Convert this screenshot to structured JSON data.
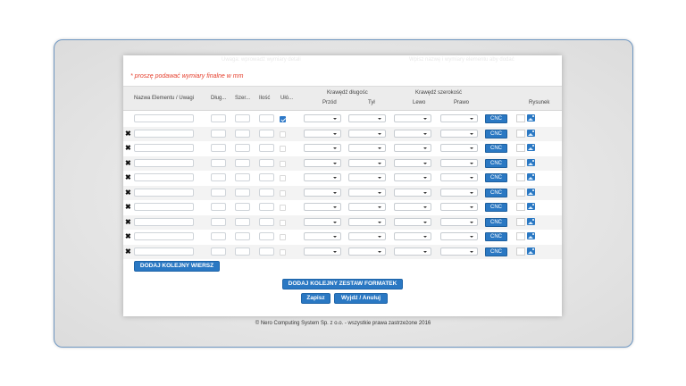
{
  "note": "* proszę podawać wymiary finalne w mm",
  "ghost": {
    "center": "Uwaga: wprowadź wymiary detali",
    "right": "Wpisz nazwę i wymiary elementu aby dodać"
  },
  "headers": {
    "name": "Nazwa Elementu / Uwagi",
    "length": "Dług...",
    "width": "Szer...",
    "qty": "Ilość",
    "grain": "Ułó...",
    "edge_length": "Krawędź długośc",
    "front": "Przód",
    "back": "Tył",
    "edge_width": "Krawędź szerokość",
    "left": "Lewo",
    "right": "Prawo",
    "drawing": "Rysunek"
  },
  "rows": [
    {
      "deletable": false,
      "grain_checked": true
    },
    {
      "deletable": true,
      "grain_checked": false
    },
    {
      "deletable": true,
      "grain_checked": false
    },
    {
      "deletable": true,
      "grain_checked": false
    },
    {
      "deletable": true,
      "grain_checked": false
    },
    {
      "deletable": true,
      "grain_checked": false
    },
    {
      "deletable": true,
      "grain_checked": false
    },
    {
      "deletable": true,
      "grain_checked": false
    },
    {
      "deletable": true,
      "grain_checked": false
    },
    {
      "deletable": true,
      "grain_checked": false
    }
  ],
  "cnc_label": "CNC",
  "delete_symbol": "✖",
  "buttons": {
    "add_row": "DODAJ KOLEJNY WIERSZ",
    "add_set": "DODAJ KOLEJNY ZESTAW FORMATEK",
    "save": "Zapisz",
    "exit": "Wyjdź / Anuluj"
  },
  "footer": "© Nero Computing System Sp. z o.o. - wszystkie prawa zastrzeżone 2016",
  "colors": {
    "accent": "#2a78c3",
    "note": "#e5402e",
    "frame_border": "#6f97c2"
  }
}
